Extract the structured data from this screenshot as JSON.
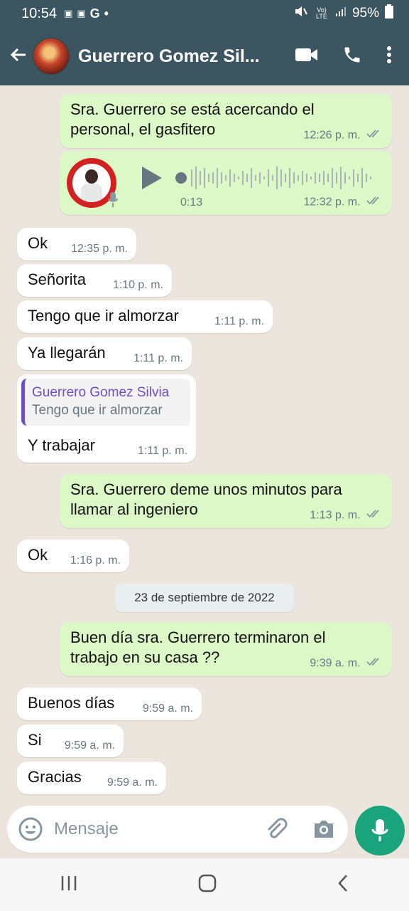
{
  "status_bar": {
    "time": "10:54",
    "notifications": [
      "▣",
      "▣",
      "G",
      "•"
    ],
    "network": "Vo) LTE",
    "battery": "95%"
  },
  "header": {
    "title": "Guerrero Gomez Sil...",
    "back_icon": "arrow-left-icon",
    "video_icon": "video-call-icon",
    "call_icon": "phone-icon",
    "menu_icon": "more-vert-icon"
  },
  "messages": [
    {
      "dir": "out",
      "text": "Sra. Guerrero se está acercando el personal, el gasfitero",
      "time": "12:26 p. m."
    },
    {
      "dir": "out",
      "type": "voice",
      "duration": "0:13",
      "time": "12:32 p. m."
    },
    {
      "dir": "in",
      "text": "Ok",
      "time": "12:35 p. m."
    },
    {
      "dir": "in",
      "text": "Señorita",
      "time": "1:10 p. m."
    },
    {
      "dir": "in",
      "text": "Tengo que ir almorzar",
      "time": "1:11 p. m."
    },
    {
      "dir": "in",
      "text": "Ya llegarán",
      "time": "1:11 p. m."
    },
    {
      "dir": "in",
      "text": "Y trabajar",
      "time": "1:11 p. m.",
      "quote": {
        "name": "Guerrero Gomez Silvia",
        "text": "Tengo que ir almorzar"
      }
    },
    {
      "dir": "out",
      "text": "Sra. Guerrero deme unos minutos para llamar al ingeniero",
      "time": "1:13 p. m."
    },
    {
      "dir": "in",
      "text": "Ok",
      "time": "1:16 p. m."
    },
    {
      "dir": "out",
      "text": "Buen día sra. Guerrero terminaron el trabajo en su casa ??",
      "time": "9:39 a. m."
    },
    {
      "dir": "in",
      "text": "Buenos días",
      "time": "9:59 a. m."
    },
    {
      "dir": "in",
      "text": "Si",
      "time": "9:59 a. m."
    },
    {
      "dir": "in",
      "text": "Gracias",
      "time": "9:59 a. m."
    }
  ],
  "date_divider": "23 de septiembre de 2022",
  "input": {
    "placeholder": "Mensaje",
    "emoji_icon": "emoji-icon",
    "attach_icon": "paperclip-icon",
    "camera_icon": "camera-icon",
    "mic_icon": "mic-icon"
  },
  "colors": {
    "header": "#3b5561",
    "outgoing": "#dcf8c6",
    "incoming": "#ffffff",
    "accent": "#1aa47c",
    "quote_bar": "#6b4fc7"
  }
}
